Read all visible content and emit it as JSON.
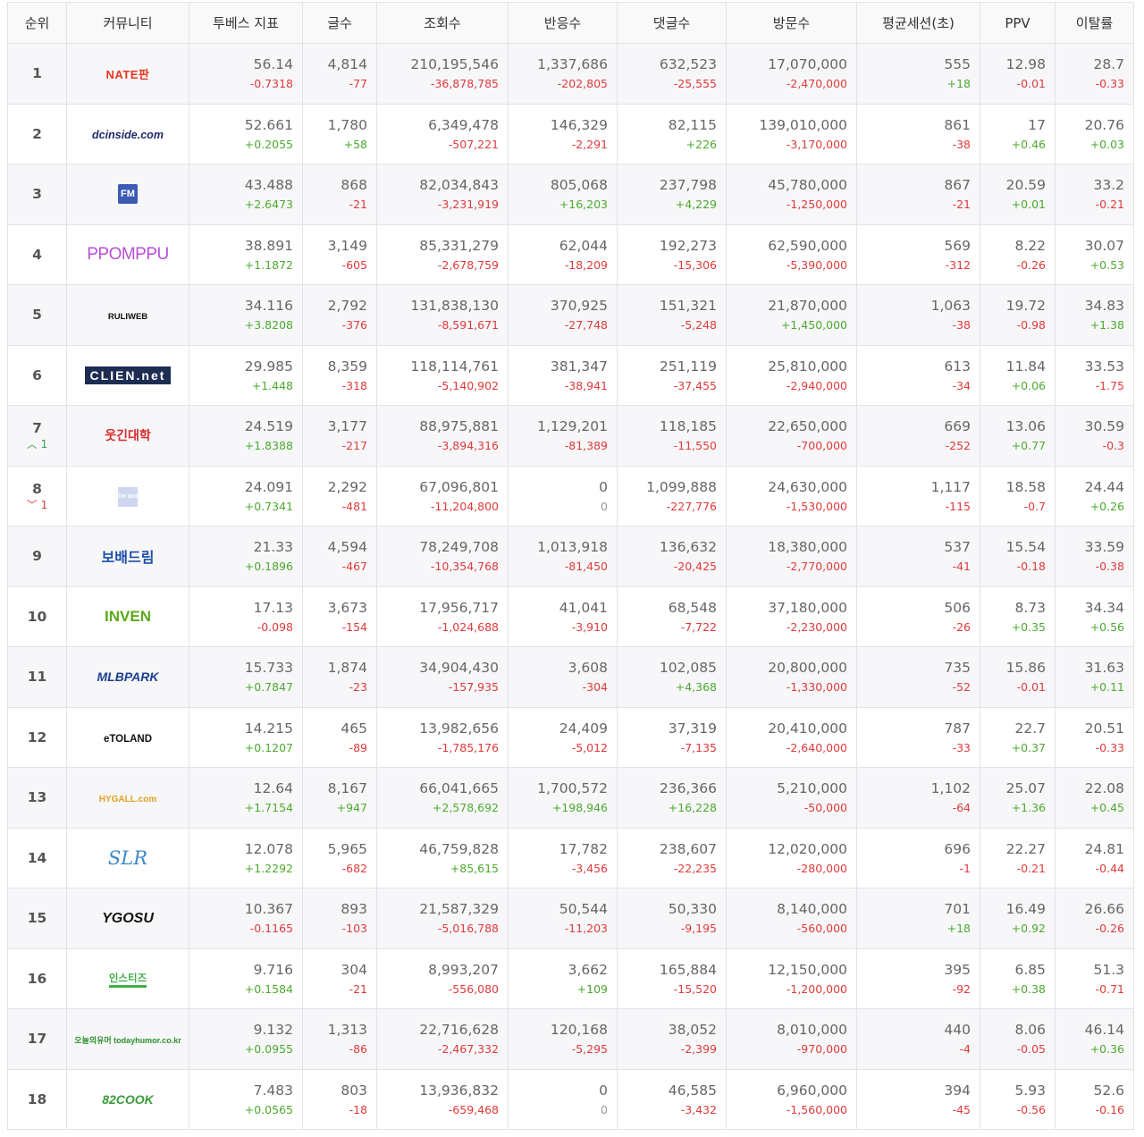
{
  "headers": [
    "순위",
    "커뮤니티",
    "투베스 지표",
    "글수",
    "조회수",
    "반응수",
    "댓글수",
    "방문수",
    "평균세션(초)",
    "PPV",
    "이탈률"
  ],
  "rows": [
    {
      "rank": "1",
      "rank_change": null,
      "logo": "NATE판",
      "logo_style": "nate",
      "values": [
        [
          "56.14",
          "-0.7318"
        ],
        [
          "4,814",
          "-77"
        ],
        [
          "210,195,546",
          "-36,878,785"
        ],
        [
          "1,337,686",
          "-202,805"
        ],
        [
          "632,523",
          "-25,555"
        ],
        [
          "17,070,000",
          "-2,470,000"
        ],
        [
          "555",
          "+18"
        ],
        [
          "12.98",
          "-0.01"
        ],
        [
          "28.7",
          "-0.33"
        ]
      ]
    },
    {
      "rank": "2",
      "rank_change": null,
      "logo": "dcinside.com",
      "logo_style": "dc",
      "values": [
        [
          "52.661",
          "+0.2055"
        ],
        [
          "1,780",
          "+58"
        ],
        [
          "6,349,478",
          "-507,221"
        ],
        [
          "146,329",
          "-2,291"
        ],
        [
          "82,115",
          "+226"
        ],
        [
          "139,010,000",
          "-3,170,000"
        ],
        [
          "861",
          "-38"
        ],
        [
          "17",
          "+0.46"
        ],
        [
          "20.76",
          "+0.03"
        ]
      ]
    },
    {
      "rank": "3",
      "rank_change": null,
      "logo": "FM",
      "logo_style": "fm",
      "values": [
        [
          "43.488",
          "+2.6473"
        ],
        [
          "868",
          "-21"
        ],
        [
          "82,034,843",
          "-3,231,919"
        ],
        [
          "805,068",
          "+16,203"
        ],
        [
          "237,798",
          "+4,229"
        ],
        [
          "45,780,000",
          "-1,250,000"
        ],
        [
          "867",
          "-21"
        ],
        [
          "20.59",
          "+0.01"
        ],
        [
          "33.2",
          "-0.21"
        ]
      ]
    },
    {
      "rank": "4",
      "rank_change": null,
      "logo": "PPOMPPU",
      "logo_style": "ppomppu",
      "values": [
        [
          "38.891",
          "+1.1872"
        ],
        [
          "3,149",
          "-605"
        ],
        [
          "85,331,279",
          "-2,678,759"
        ],
        [
          "62,044",
          "-18,209"
        ],
        [
          "192,273",
          "-15,306"
        ],
        [
          "62,590,000",
          "-5,390,000"
        ],
        [
          "569",
          "-312"
        ],
        [
          "8.22",
          "-0.26"
        ],
        [
          "30.07",
          "+0.53"
        ]
      ]
    },
    {
      "rank": "5",
      "rank_change": null,
      "logo": "RULIWEB",
      "logo_style": "ruliweb",
      "values": [
        [
          "34.116",
          "+3.8208"
        ],
        [
          "2,792",
          "-376"
        ],
        [
          "131,838,130",
          "-8,591,671"
        ],
        [
          "370,925",
          "-27,748"
        ],
        [
          "151,321",
          "-5,248"
        ],
        [
          "21,870,000",
          "+1,450,000"
        ],
        [
          "1,063",
          "-38"
        ],
        [
          "19.72",
          "-0.98"
        ],
        [
          "34.83",
          "+1.38"
        ]
      ]
    },
    {
      "rank": "6",
      "rank_change": null,
      "logo": "CLIEN.net",
      "logo_style": "clien",
      "values": [
        [
          "29.985",
          "+1.448"
        ],
        [
          "8,359",
          "-318"
        ],
        [
          "118,114,761",
          "-5,140,902"
        ],
        [
          "381,347",
          "-38,941"
        ],
        [
          "251,119",
          "-37,455"
        ],
        [
          "25,810,000",
          "-2,940,000"
        ],
        [
          "613",
          "-34"
        ],
        [
          "11.84",
          "+0.06"
        ],
        [
          "33.53",
          "-1.75"
        ]
      ]
    },
    {
      "rank": "7",
      "rank_change": {
        "dir": "up",
        "arrow": "︿",
        "text": "1"
      },
      "logo": "웃긴대학",
      "logo_style": "humor",
      "values": [
        [
          "24.519",
          "+1.8388"
        ],
        [
          "3,177",
          "-217"
        ],
        [
          "88,975,881",
          "-3,894,316"
        ],
        [
          "1,129,201",
          "-81,389"
        ],
        [
          "118,185",
          "-11,550"
        ],
        [
          "22,650,000",
          "-700,000"
        ],
        [
          "669",
          "-252"
        ],
        [
          "13.06",
          "+0.77"
        ],
        [
          "30.59",
          "-0.3"
        ]
      ]
    },
    {
      "rank": "8",
      "rank_change": {
        "dir": "down",
        "arrow": "﹀",
        "text": "1"
      },
      "logo": "the qoo",
      "logo_style": "theqoo",
      "values": [
        [
          "24.091",
          "+0.7341"
        ],
        [
          "2,292",
          "-481"
        ],
        [
          "67,096,801",
          "-11,204,800"
        ],
        [
          "0",
          "0"
        ],
        [
          "1,099,888",
          "-227,776"
        ],
        [
          "24,630,000",
          "-1,530,000"
        ],
        [
          "1,117",
          "-115"
        ],
        [
          "18.58",
          "-0.7"
        ],
        [
          "24.44",
          "+0.26"
        ]
      ]
    },
    {
      "rank": "9",
      "rank_change": null,
      "logo": "보배드림",
      "logo_style": "bobae",
      "values": [
        [
          "21.33",
          "+0.1896"
        ],
        [
          "4,594",
          "-467"
        ],
        [
          "78,249,708",
          "-10,354,768"
        ],
        [
          "1,013,918",
          "-81,450"
        ],
        [
          "136,632",
          "-20,425"
        ],
        [
          "18,380,000",
          "-2,770,000"
        ],
        [
          "537",
          "-41"
        ],
        [
          "15.54",
          "-0.18"
        ],
        [
          "33.59",
          "-0.38"
        ]
      ]
    },
    {
      "rank": "10",
      "rank_change": null,
      "logo": "INVEN",
      "logo_style": "inven",
      "values": [
        [
          "17.13",
          "-0.098"
        ],
        [
          "3,673",
          "-154"
        ],
        [
          "17,956,717",
          "-1,024,688"
        ],
        [
          "41,041",
          "-3,910"
        ],
        [
          "68,548",
          "-7,722"
        ],
        [
          "37,180,000",
          "-2,230,000"
        ],
        [
          "506",
          "-26"
        ],
        [
          "8.73",
          "+0.35"
        ],
        [
          "34.34",
          "+0.56"
        ]
      ]
    },
    {
      "rank": "11",
      "rank_change": null,
      "logo": "MLBPARK",
      "logo_style": "mlb",
      "values": [
        [
          "15.733",
          "+0.7847"
        ],
        [
          "1,874",
          "-23"
        ],
        [
          "34,904,430",
          "-157,935"
        ],
        [
          "3,608",
          "-304"
        ],
        [
          "102,085",
          "+4,368"
        ],
        [
          "20,800,000",
          "-1,330,000"
        ],
        [
          "735",
          "-52"
        ],
        [
          "15.86",
          "-0.01"
        ],
        [
          "31.63",
          "+0.11"
        ]
      ]
    },
    {
      "rank": "12",
      "rank_change": null,
      "logo": "eTOLAND",
      "logo_style": "etoland",
      "values": [
        [
          "14.215",
          "+0.1207"
        ],
        [
          "465",
          "-89"
        ],
        [
          "13,982,656",
          "-1,785,176"
        ],
        [
          "24,409",
          "-5,012"
        ],
        [
          "37,319",
          "-7,135"
        ],
        [
          "20,410,000",
          "-2,640,000"
        ],
        [
          "787",
          "-33"
        ],
        [
          "22.7",
          "+0.37"
        ],
        [
          "20.51",
          "-0.33"
        ]
      ]
    },
    {
      "rank": "13",
      "rank_change": null,
      "logo": "HYGALL.com",
      "logo_style": "hygall",
      "values": [
        [
          "12.64",
          "+1.7154"
        ],
        [
          "8,167",
          "+947"
        ],
        [
          "66,041,665",
          "+2,578,692"
        ],
        [
          "1,700,572",
          "+198,946"
        ],
        [
          "236,366",
          "+16,228"
        ],
        [
          "5,210,000",
          "-50,000"
        ],
        [
          "1,102",
          "-64"
        ],
        [
          "25.07",
          "+1.36"
        ],
        [
          "22.08",
          "+0.45"
        ]
      ]
    },
    {
      "rank": "14",
      "rank_change": null,
      "logo": "SLR",
      "logo_style": "slr",
      "values": [
        [
          "12.078",
          "+1.2292"
        ],
        [
          "5,965",
          "-682"
        ],
        [
          "46,759,828",
          "+85,615"
        ],
        [
          "17,782",
          "-3,456"
        ],
        [
          "238,607",
          "-22,235"
        ],
        [
          "12,020,000",
          "-280,000"
        ],
        [
          "696",
          "-1"
        ],
        [
          "22.27",
          "-0.21"
        ],
        [
          "24.81",
          "-0.44"
        ]
      ]
    },
    {
      "rank": "15",
      "rank_change": null,
      "logo": "YGOSU",
      "logo_style": "ygosu",
      "values": [
        [
          "10.367",
          "-0.1165"
        ],
        [
          "893",
          "-103"
        ],
        [
          "21,587,329",
          "-5,016,788"
        ],
        [
          "50,544",
          "-11,203"
        ],
        [
          "50,330",
          "-9,195"
        ],
        [
          "8,140,000",
          "-560,000"
        ],
        [
          "701",
          "+18"
        ],
        [
          "16.49",
          "+0.92"
        ],
        [
          "26.66",
          "-0.26"
        ]
      ]
    },
    {
      "rank": "16",
      "rank_change": null,
      "logo": "인스티즈",
      "logo_style": "instiz",
      "values": [
        [
          "9.716",
          "+0.1584"
        ],
        [
          "304",
          "-21"
        ],
        [
          "8,993,207",
          "-556,080"
        ],
        [
          "3,662",
          "+109"
        ],
        [
          "165,884",
          "-15,520"
        ],
        [
          "12,150,000",
          "-1,200,000"
        ],
        [
          "395",
          "-92"
        ],
        [
          "6.85",
          "+0.38"
        ],
        [
          "51.3",
          "-0.71"
        ]
      ]
    },
    {
      "rank": "17",
      "rank_change": null,
      "logo": "오늘의유머 todayhumor.co.kr",
      "logo_style": "todayhumor",
      "values": [
        [
          "9.132",
          "+0.0955"
        ],
        [
          "1,313",
          "-86"
        ],
        [
          "22,716,628",
          "-2,467,332"
        ],
        [
          "120,168",
          "-5,295"
        ],
        [
          "38,052",
          "-2,399"
        ],
        [
          "8,010,000",
          "-970,000"
        ],
        [
          "440",
          "-4"
        ],
        [
          "8.06",
          "-0.05"
        ],
        [
          "46.14",
          "+0.36"
        ]
      ]
    },
    {
      "rank": "18",
      "rank_change": null,
      "logo": "82COOK",
      "logo_style": "cook",
      "values": [
        [
          "7.483",
          "+0.0565"
        ],
        [
          "803",
          "-18"
        ],
        [
          "13,936,832",
          "-659,468"
        ],
        [
          "0",
          "0"
        ],
        [
          "46,585",
          "-3,432"
        ],
        [
          "6,960,000",
          "-1,560,000"
        ],
        [
          "394",
          "-45"
        ],
        [
          "5.93",
          "-0.56"
        ],
        [
          "52.6",
          "-0.16"
        ]
      ]
    }
  ],
  "colors": {
    "negative": "#e03a3a",
    "positive": "#4caa2e",
    "zero": "#999999",
    "row_alt": "#f7f7f9",
    "border": "#e3e3e6"
  }
}
